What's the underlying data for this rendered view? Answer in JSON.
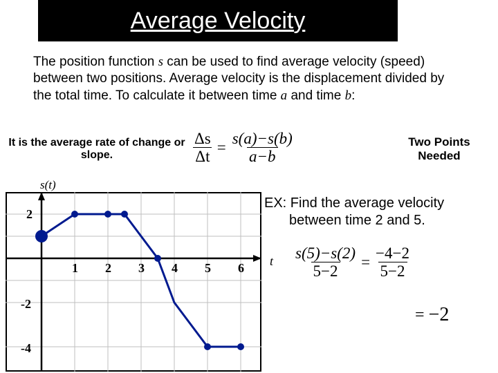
{
  "title": "Average Velocity",
  "description": {
    "part1": "The position function ",
    "s": "s",
    "part2": " can be used to find average velocity (speed) between two positions.  Average velocity is the displacement divided by the total time.  To calculate it between time ",
    "a": "a",
    "part3": " and time ",
    "b": "b",
    "part4": ":"
  },
  "left_note": "It is the average rate of change or slope.",
  "right_note": "Two Points Needed",
  "formula": {
    "ds": "Δs",
    "dt": "Δt",
    "eq": "=",
    "num": "s(a)−s(b)",
    "den": "a−b"
  },
  "axis": {
    "y": "s(t)",
    "x": "t"
  },
  "ticks": {
    "y_2": "2",
    "y_m2": "-2",
    "y_m4": "-4",
    "x_1": "1",
    "x_2": "2",
    "x_3": "3",
    "x_4": "4",
    "x_5": "5",
    "x_6": "6"
  },
  "example": {
    "line1": "EX: Find the average velocity",
    "line2": "between time 2 and 5."
  },
  "ex_formula": {
    "num1": "s(5)−s(2)",
    "den1": "5−2",
    "eq": "=",
    "num2": "−4−2",
    "den2": "5−2"
  },
  "ex_formula2": {
    "eq": "=",
    "val": "−2"
  },
  "chart_data": {
    "type": "line",
    "xlabel": "t",
    "ylabel": "s(t)",
    "xlim": [
      -1,
      6.8
    ],
    "ylim": [
      -5,
      3
    ],
    "x": [
      0,
      1,
      2,
      2.5,
      3.5,
      4,
      5,
      6
    ],
    "y": [
      1,
      2,
      2,
      2,
      0,
      -2,
      -4,
      -4
    ],
    "markers_x": [
      0,
      1,
      2,
      2.5,
      3.5,
      5,
      6
    ],
    "markers_y": [
      1,
      2,
      2,
      2,
      0,
      -4,
      -4
    ]
  }
}
